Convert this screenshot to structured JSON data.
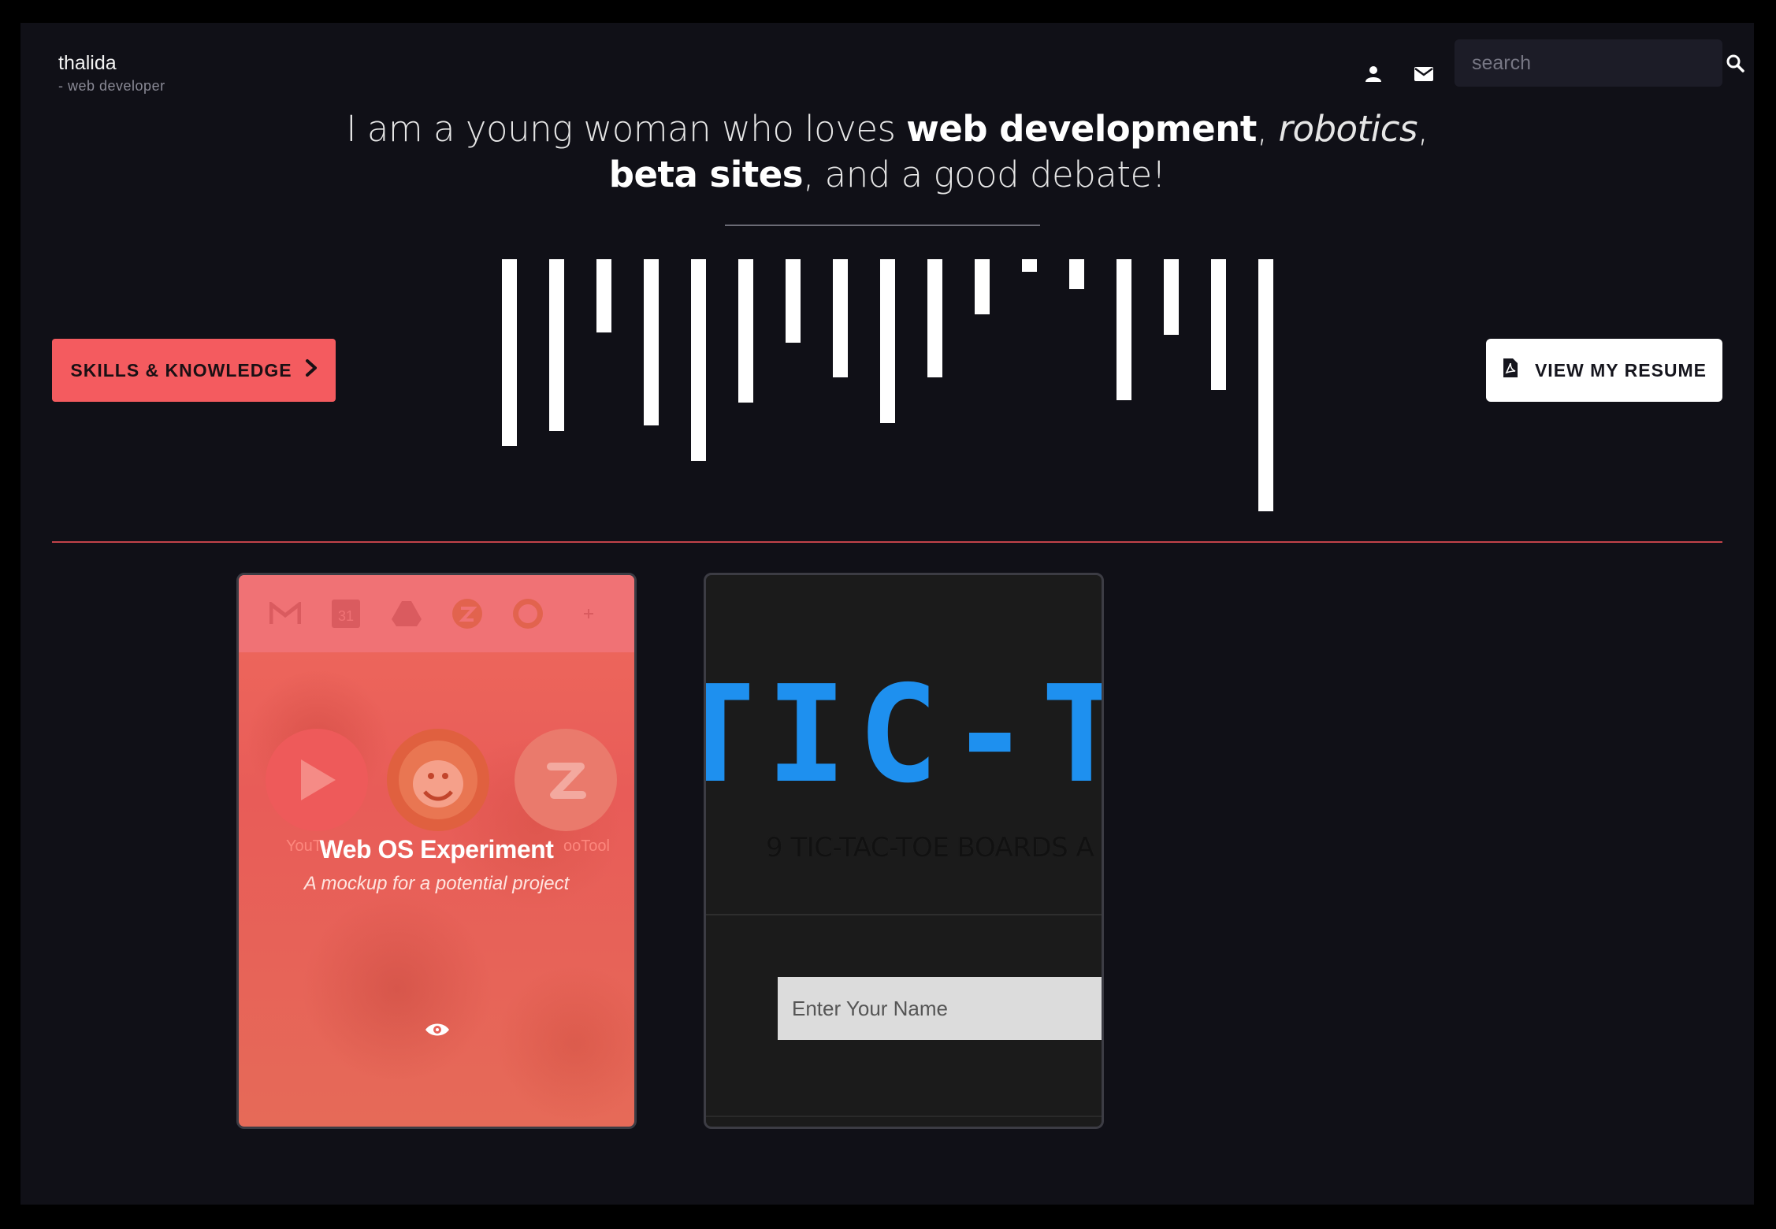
{
  "brand": {
    "name": "thalida",
    "tagline": "- web developer"
  },
  "header": {
    "icons": [
      "user-icon",
      "envelope-icon"
    ],
    "search": {
      "placeholder": "search",
      "value": "",
      "icon": "search-icon"
    }
  },
  "hero": {
    "line1_pre": "I am a young woman who loves ",
    "line1_bold": "web development",
    "line1_mid": ", ",
    "line1_italic": "robotics",
    "line1_end": ",",
    "line2_bold": "beta sites",
    "line2_end": ", and a good debate!"
  },
  "bars": {
    "color": "#ffffff",
    "levels": [
      0.74,
      0.68,
      0.29,
      0.66,
      0.8,
      0.57,
      0.33,
      0.47,
      0.65,
      0.47,
      0.22,
      0.05,
      0.12,
      0.56,
      0.3,
      0.52,
      1.0
    ]
  },
  "buttons": {
    "skills_label": "SKILLS & KNOWLEDGE",
    "resume_label": "VIEW MY RESUME"
  },
  "colors": {
    "accent": "#f45b5f",
    "background": "#101017",
    "rule": "#c2434a",
    "ttt_blue": "#1e90ef"
  },
  "projects": [
    {
      "title": "Web OS Experiment",
      "subtitle": "A mockup for a potential project",
      "app_labels": [
        "YouTu",
        "ooTool"
      ]
    },
    {
      "screenshot_title": "TIC-TA",
      "screenshot_subtitle": "9 TIC-TAC-TOE BOARDS A",
      "name_placeholder": "Enter Your Name"
    }
  ]
}
